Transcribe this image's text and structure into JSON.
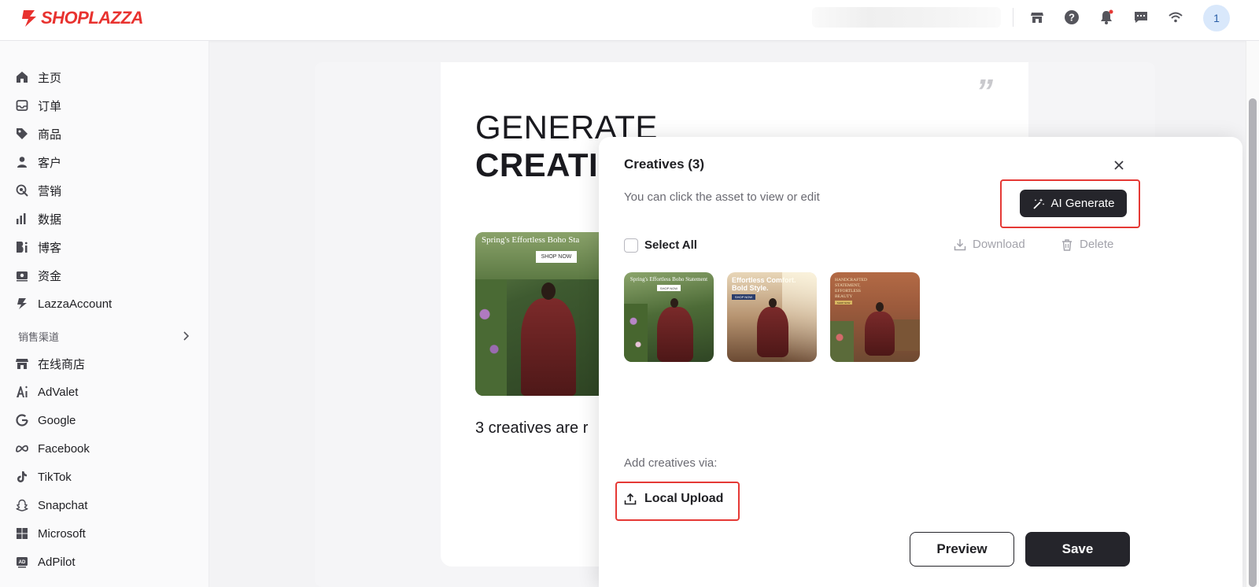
{
  "brand": {
    "name": "SHOPLAZZA",
    "color": "#e8322f"
  },
  "topbar": {
    "icons": [
      "store-icon",
      "help-icon",
      "bell-icon",
      "chat-icon",
      "wifi-icon"
    ],
    "avatar_initial": "1"
  },
  "sidebar": {
    "items": [
      {
        "label": "主页",
        "icon": "home-icon"
      },
      {
        "label": "订单",
        "icon": "inbox-icon"
      },
      {
        "label": "商品",
        "icon": "tag-icon"
      },
      {
        "label": "客户",
        "icon": "user-icon"
      },
      {
        "label": "营销",
        "icon": "marketing-icon"
      },
      {
        "label": "数据",
        "icon": "bar-chart-icon"
      },
      {
        "label": "博客",
        "icon": "blog-icon"
      },
      {
        "label": "资金",
        "icon": "wallet-icon"
      },
      {
        "label": "LazzaAccount",
        "icon": "lightning-icon"
      }
    ],
    "section_title": "销售渠道",
    "channels": [
      {
        "label": "在线商店",
        "icon": "store-icon"
      },
      {
        "label": "AdValet",
        "icon": "advalet-icon"
      },
      {
        "label": "Google",
        "icon": "google-icon"
      },
      {
        "label": "Facebook",
        "icon": "meta-icon"
      },
      {
        "label": "TikTok",
        "icon": "tiktok-icon"
      },
      {
        "label": "Snapchat",
        "icon": "snapchat-icon"
      },
      {
        "label": "Microsoft",
        "icon": "microsoft-icon"
      },
      {
        "label": "AdPilot",
        "icon": "adpilot-icon"
      }
    ]
  },
  "hero": {
    "title_line1": "GENERATE",
    "title_line2": "CREATI",
    "image_caption": "Spring's Effortless Boho Sta",
    "image_button": "SHOP NOW",
    "caption": "3 creatives are r",
    "quote_mark": "”"
  },
  "modal": {
    "title": "Creatives (3)",
    "subtitle": "You can click the asset to view or edit",
    "ai_generate_label": "AI Generate",
    "select_all_label": "Select All",
    "download_label": "Download",
    "delete_label": "Delete",
    "creatives": [
      {
        "caption": "Spring's Effortless Boho Statement",
        "button": "SHOP NOW"
      },
      {
        "caption": "Effortless Comfort. Bold Style.",
        "button": "SHOP NOW"
      },
      {
        "caption": "HANDCRAFTED STATEMENT, EFFORTLESS BEAUTY",
        "button": "SHOP NOW"
      }
    ],
    "add_label": "Add creatives via:",
    "local_upload_label": "Local Upload",
    "preview_label": "Preview",
    "save_label": "Save"
  },
  "colors": {
    "primary_dark": "#25252b",
    "highlight": "#e53935"
  }
}
